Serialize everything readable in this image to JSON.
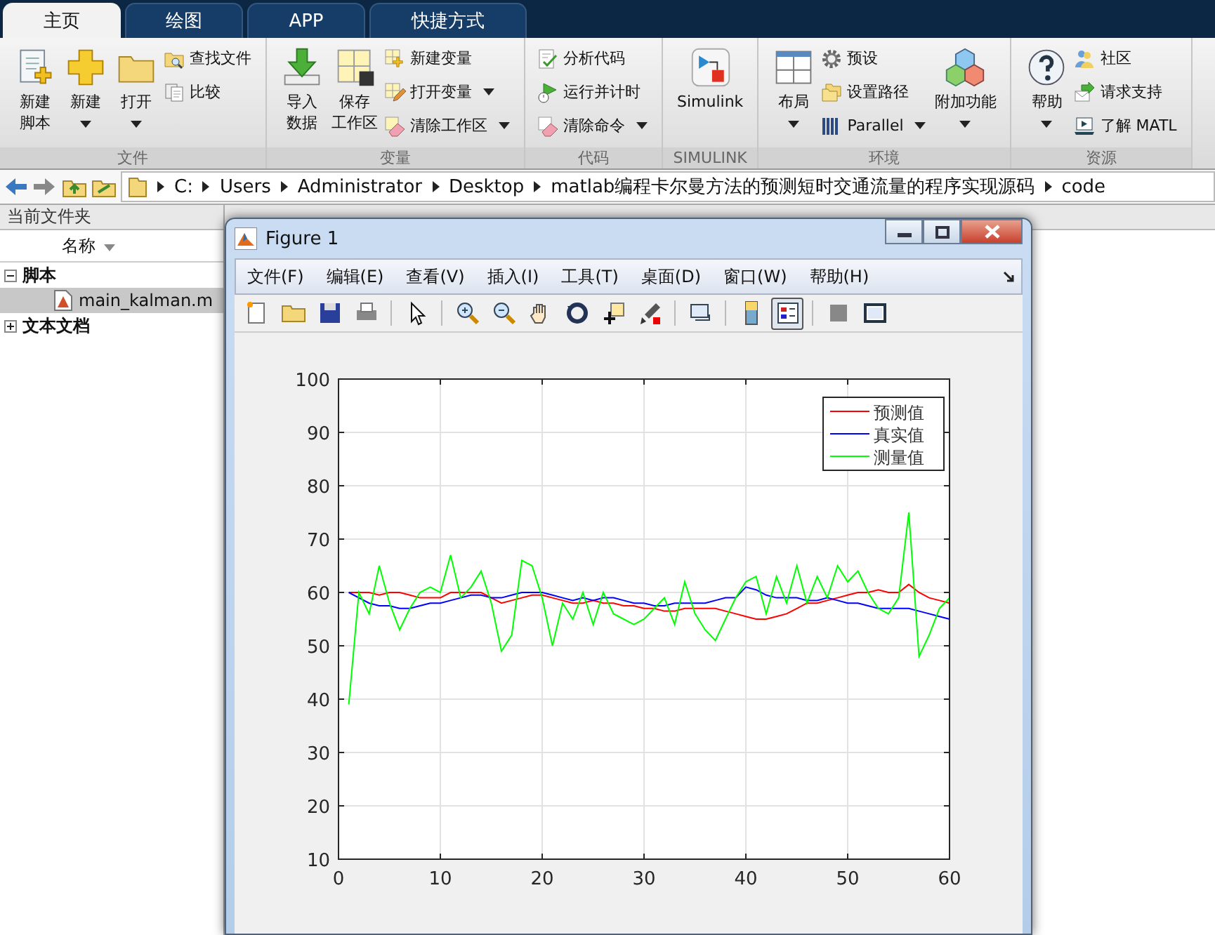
{
  "tabs": [
    {
      "label": "主页",
      "selected": true
    },
    {
      "label": "绘图",
      "selected": false
    },
    {
      "label": "APP",
      "selected": false
    },
    {
      "label": "快捷方式",
      "selected": false
    }
  ],
  "ribbon": [
    {
      "label": "文件",
      "items": [
        {
          "kind": "large",
          "lines": [
            "新建",
            "脚本"
          ],
          "dropdown": false
        },
        {
          "kind": "large",
          "lines": [
            "新建"
          ],
          "dropdown": true
        },
        {
          "kind": "large",
          "lines": [
            "打开"
          ],
          "dropdown": true
        },
        {
          "kind": "stack",
          "items": [
            {
              "label": "查找文件",
              "dropdown": false
            },
            {
              "label": "比较",
              "dropdown": false
            }
          ]
        }
      ]
    },
    {
      "label": "变量",
      "items": [
        {
          "kind": "large",
          "lines": [
            "导入",
            "数据"
          ],
          "dropdown": false
        },
        {
          "kind": "large",
          "lines": [
            "保存",
            "工作区"
          ],
          "dropdown": false
        },
        {
          "kind": "stack",
          "items": [
            {
              "label": "新建变量",
              "dropdown": false
            },
            {
              "label": "打开变量",
              "dropdown": true
            },
            {
              "label": "清除工作区",
              "dropdown": true
            }
          ]
        }
      ]
    },
    {
      "label": "代码",
      "items": [
        {
          "kind": "stack",
          "items": [
            {
              "label": "分析代码",
              "dropdown": false
            },
            {
              "label": "运行并计时",
              "dropdown": false
            },
            {
              "label": "清除命令",
              "dropdown": true
            }
          ]
        }
      ]
    },
    {
      "label": "SIMULINK",
      "items": [
        {
          "kind": "large",
          "lines": [
            "Simulink"
          ],
          "dropdown": false
        }
      ]
    },
    {
      "label": "环境",
      "items": [
        {
          "kind": "large",
          "lines": [
            "布局"
          ],
          "dropdown": true
        },
        {
          "kind": "stack",
          "items": [
            {
              "label": "预设",
              "dropdown": false
            },
            {
              "label": "设置路径",
              "dropdown": false
            },
            {
              "label": "Parallel",
              "dropdown": true
            }
          ]
        },
        {
          "kind": "large",
          "lines": [
            "附加功能"
          ],
          "dropdown": true
        }
      ]
    },
    {
      "label": "资源",
      "items": [
        {
          "kind": "large",
          "lines": [
            "帮助"
          ],
          "dropdown": true
        },
        {
          "kind": "stack",
          "items": [
            {
              "label": "社区",
              "dropdown": false
            },
            {
              "label": "请求支持",
              "dropdown": false
            },
            {
              "label": "了解 MATL",
              "dropdown": false
            }
          ]
        }
      ]
    }
  ],
  "address": {
    "path": [
      "C:",
      "Users",
      "Administrator",
      "Desktop",
      "matlab编程卡尔曼方法的预测短时交通流量的程序实现源码",
      "code"
    ]
  },
  "file_panel": {
    "title": "当前文件夹",
    "column": "名称",
    "tree": [
      {
        "label": "脚本",
        "expanded": true,
        "children": [
          {
            "label": "main_kalman.m",
            "selected": true
          }
        ]
      },
      {
        "label": "文本文档",
        "expanded": false
      }
    ]
  },
  "figure": {
    "title": "Figure 1",
    "menu": [
      "文件(F)",
      "编辑(E)",
      "查看(V)",
      "插入(I)",
      "工具(T)",
      "桌面(D)",
      "窗口(W)",
      "帮助(H)"
    ],
    "toolbar": [
      {
        "pressed": false
      },
      {
        "pressed": false
      },
      {
        "pressed": false
      },
      {
        "pressed": false
      },
      {
        "pressed": false
      },
      {
        "pressed": false
      },
      {
        "pressed": false
      },
      {
        "pressed": false
      },
      {
        "pressed": false
      },
      {
        "pressed": false
      },
      {
        "pressed": false
      },
      {
        "pressed": false
      },
      {
        "pressed": false
      },
      {
        "pressed": true
      },
      {
        "pressed": false
      },
      {
        "pressed": false
      }
    ],
    "chart_data": {
      "type": "line",
      "x": [
        1,
        2,
        3,
        4,
        5,
        6,
        7,
        8,
        9,
        10,
        11,
        12,
        13,
        14,
        15,
        16,
        17,
        18,
        19,
        20,
        21,
        22,
        23,
        24,
        25,
        26,
        27,
        28,
        29,
        30,
        31,
        32,
        33,
        34,
        35,
        36,
        37,
        38,
        39,
        40,
        41,
        42,
        43,
        44,
        45,
        46,
        47,
        48,
        49,
        50,
        51,
        52,
        53,
        54,
        55,
        56,
        57,
        58,
        59,
        60
      ],
      "series": [
        {
          "name": "预测值",
          "color": "#ff0000",
          "values": [
            60,
            60,
            60,
            59.5,
            60,
            60,
            59.5,
            59,
            59,
            59,
            60,
            60,
            60,
            60,
            59,
            58,
            58.5,
            59,
            59.5,
            59.5,
            59,
            58.5,
            58,
            58,
            58.5,
            58,
            58,
            57.5,
            57.5,
            57,
            57,
            56.5,
            56.5,
            57,
            57,
            57,
            57,
            56.5,
            56,
            55.5,
            55,
            55,
            55.5,
            56,
            57,
            58,
            58,
            58.5,
            59,
            59.5,
            60,
            60,
            60.5,
            60,
            60,
            61.5,
            60,
            59,
            58.5,
            58
          ]
        },
        {
          "name": "真实值",
          "color": "#0000ff",
          "values": [
            60,
            59,
            58,
            57.5,
            57.5,
            57,
            57,
            57.5,
            58,
            58,
            58.5,
            59,
            59.5,
            59.5,
            59,
            59,
            59.5,
            60,
            60,
            60,
            59.5,
            59,
            58.5,
            59,
            58.5,
            59,
            59,
            58.5,
            58,
            58,
            57.5,
            57.5,
            58,
            58,
            58,
            58,
            58.5,
            59,
            59,
            61,
            60.5,
            59.5,
            59,
            59,
            59,
            58.5,
            58.5,
            59,
            58.5,
            58,
            58,
            57.5,
            57,
            57,
            57,
            57,
            56.5,
            56,
            55.5,
            55
          ]
        },
        {
          "name": "测量值",
          "color": "#00ff00",
          "values": [
            39,
            60,
            56,
            65,
            58,
            53,
            57,
            60,
            61,
            60,
            67,
            59,
            61,
            64,
            58,
            49,
            52,
            66,
            65,
            59,
            50,
            58,
            55,
            60,
            54,
            60,
            56,
            55,
            54,
            55,
            57,
            59,
            54,
            62,
            56,
            53,
            51,
            55,
            59,
            62,
            63,
            56,
            63,
            58,
            65,
            58,
            63,
            59,
            65,
            62,
            64,
            60,
            57,
            56,
            59,
            75,
            48,
            52,
            57,
            59
          ]
        }
      ],
      "grid": true,
      "legend": true,
      "xlim": [
        0,
        60
      ],
      "ylim": [
        10,
        100
      ],
      "xticks": [
        0,
        10,
        20,
        30,
        40,
        50,
        60
      ],
      "yticks": [
        10,
        20,
        30,
        40,
        50,
        60,
        70,
        80,
        90,
        100
      ]
    }
  }
}
